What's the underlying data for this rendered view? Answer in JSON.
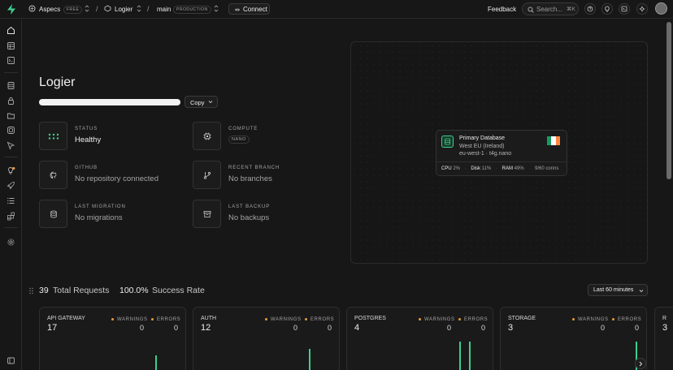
{
  "topbar": {
    "org": "Aspecs",
    "org_plan": "FREE",
    "project": "Logier",
    "branch": "main",
    "branch_env": "PRODUCTION",
    "connect": "Connect",
    "feedback": "Feedback",
    "search_placeholder": "Search...",
    "search_shortcut": "⌘K"
  },
  "project": {
    "title": "Logier",
    "copy_label": "Copy"
  },
  "stats": {
    "status": {
      "label": "STATUS",
      "value": "Healthy"
    },
    "compute": {
      "label": "COMPUTE",
      "value": "NANO"
    },
    "github": {
      "label": "GITHUB",
      "value": "No repository connected"
    },
    "recent_branch": {
      "label": "RECENT BRANCH",
      "value": "No branches"
    },
    "last_migration": {
      "label": "LAST MIGRATION",
      "value": "No migrations"
    },
    "last_backup": {
      "label": "LAST BACKUP",
      "value": "No backups"
    }
  },
  "database": {
    "title": "Primary Database",
    "region": "West EU (Ireland)",
    "instance": "eu-west-1 · t4g.nano",
    "cpu_label": "CPU",
    "cpu_value": "2%",
    "disk_label": "Disk",
    "disk_value": "11%",
    "ram_label": "RAM",
    "ram_value": "49%",
    "conns": "9/60 conns"
  },
  "summary": {
    "total_count": "39",
    "total_label": "Total Requests",
    "success_rate": "100.0%",
    "success_label": "Success Rate",
    "range": "Last 60 minutes"
  },
  "legend": {
    "warnings": "WARNINGS",
    "errors": "ERRORS"
  },
  "services": [
    {
      "name": "API GATEWAY",
      "count": "17",
      "warnings": "0",
      "errors": "0"
    },
    {
      "name": "AUTH",
      "count": "12",
      "warnings": "0",
      "errors": "0"
    },
    {
      "name": "POSTGRES",
      "count": "4",
      "warnings": "0",
      "errors": "0"
    },
    {
      "name": "STORAGE",
      "count": "3",
      "warnings": "0",
      "errors": "0"
    },
    {
      "name": "R",
      "count": "3"
    }
  ],
  "colors": {
    "accent": "#3ecf8e",
    "warning_dot": "#e89a3c",
    "background": "#171717"
  }
}
